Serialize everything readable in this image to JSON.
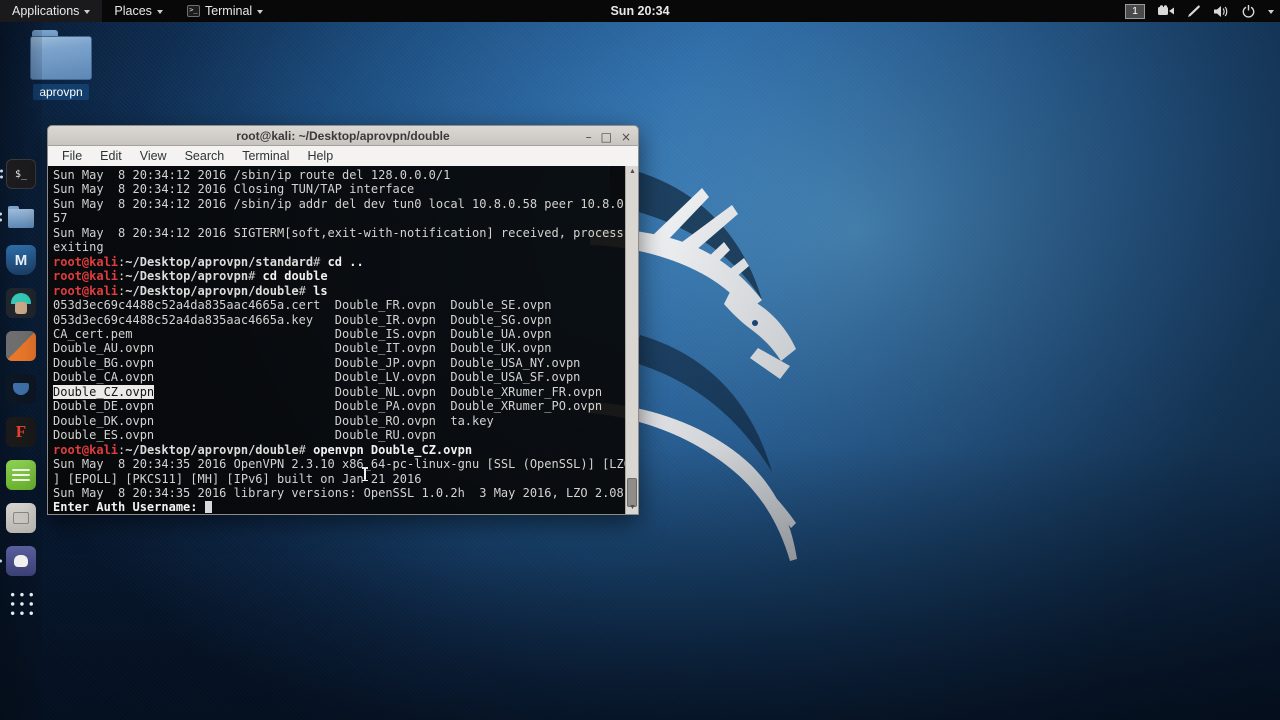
{
  "top_bar": {
    "menus": [
      {
        "label": "Applications"
      },
      {
        "label": "Places"
      },
      {
        "label": "Terminal"
      }
    ],
    "clock": "Sun 20:34",
    "workspace_label": "1",
    "tray_icons": [
      "workspace-switcher",
      "screen-recorder-icon",
      "input-pen-icon",
      "volume-icon",
      "power-icon",
      "caret-down-icon"
    ]
  },
  "desktop": {
    "folder_label": "aprovpn"
  },
  "dock": {
    "items": [
      {
        "name": "terminal",
        "glyph": "$_",
        "running_dots": 2
      },
      {
        "name": "files",
        "running_dots": 2
      },
      {
        "name": "metasploit",
        "glyph": "M",
        "running_dots": 0
      },
      {
        "name": "armitage",
        "running_dots": 0
      },
      {
        "name": "burpsuite",
        "running_dots": 0
      },
      {
        "name": "beef",
        "running_dots": 0
      },
      {
        "name": "faraday",
        "glyph": "F",
        "running_dots": 0
      },
      {
        "name": "leafpad",
        "running_dots": 0
      },
      {
        "name": "gray-app",
        "running_dots": 0
      },
      {
        "name": "dog-app",
        "running_dots": 1
      },
      {
        "name": "show-applications",
        "running_dots": 0
      }
    ]
  },
  "window": {
    "title": "root@kali: ~/Desktop/aprovpn/double",
    "controls": {
      "minimize": "–",
      "maximize": "□",
      "close": "×"
    },
    "menu": [
      "File",
      "Edit",
      "View",
      "Search",
      "Terminal",
      "Help"
    ],
    "scrollbar": {
      "up": "▲",
      "down": "▼"
    }
  },
  "terminal": {
    "columns": 80,
    "lines": [
      {
        "s": [
          [
            "d",
            "Sun May  8 20:34:12 2016 /sbin/ip route del 128.0.0.0/1"
          ]
        ]
      },
      {
        "s": [
          [
            "d",
            "Sun May  8 20:34:12 2016 Closing TUN/TAP interface"
          ]
        ]
      },
      {
        "s": [
          [
            "d",
            "Sun May  8 20:34:12 2016 /sbin/ip addr del dev tun0 local 10.8.0.58 peer 10.8.0."
          ]
        ]
      },
      {
        "s": [
          [
            "d",
            "57"
          ]
        ]
      },
      {
        "s": [
          [
            "d",
            "Sun May  8 20:34:12 2016 SIGTERM[soft,exit-with-notification] received, process"
          ]
        ]
      },
      {
        "s": [
          [
            "d",
            "exiting"
          ]
        ]
      },
      {
        "s": [
          [
            "r",
            "root@kali"
          ],
          [
            "d",
            ":"
          ],
          [
            "g",
            "~/Desktop/aprovpn/standard"
          ],
          [
            "d",
            "# "
          ],
          [
            "b",
            "cd .."
          ]
        ]
      },
      {
        "s": [
          [
            "r",
            "root@kali"
          ],
          [
            "d",
            ":"
          ],
          [
            "g",
            "~/Desktop/aprovpn"
          ],
          [
            "d",
            "# "
          ],
          [
            "b",
            "cd double"
          ]
        ]
      },
      {
        "s": [
          [
            "r",
            "root@kali"
          ],
          [
            "d",
            ":"
          ],
          [
            "g",
            "~/Desktop/aprovpn/double"
          ],
          [
            "d",
            "# "
          ],
          [
            "b",
            "ls"
          ]
        ]
      },
      {
        "s": [
          [
            "d",
            "053d3ec69c4488c52a4da835aac4665a.cert  Double_FR.ovpn  Double_SE.ovpn"
          ]
        ]
      },
      {
        "s": [
          [
            "d",
            "053d3ec69c4488c52a4da835aac4665a.key   Double_IR.ovpn  Double_SG.ovpn"
          ]
        ]
      },
      {
        "s": [
          [
            "d",
            "CA_cert.pem                            Double_IS.ovpn  Double_UA.ovpn"
          ]
        ]
      },
      {
        "s": [
          [
            "d",
            "Double_AU.ovpn                         Double_IT.ovpn  Double_UK.ovpn"
          ]
        ]
      },
      {
        "s": [
          [
            "d",
            "Double_BG.ovpn                         Double_JP.ovpn  Double_USA_NY.ovpn"
          ]
        ]
      },
      {
        "s": [
          [
            "d",
            "Double_CA.ovpn                         Double_LV.ovpn  Double_USA_SF.ovpn"
          ]
        ]
      },
      {
        "s": [
          [
            "h",
            "Double_CZ.ovpn"
          ],
          [
            "d",
            "                         Double_NL.ovpn  Double_XRumer_FR.ovpn"
          ]
        ]
      },
      {
        "s": [
          [
            "d",
            "Double_DE.ovpn                         Double_PA.ovpn  Double_XRumer_PO.ovpn"
          ]
        ]
      },
      {
        "s": [
          [
            "d",
            "Double_DK.ovpn                         Double_RO.ovpn  ta.key"
          ]
        ]
      },
      {
        "s": [
          [
            "d",
            "Double_ES.ovpn                         Double_RU.ovpn"
          ]
        ]
      },
      {
        "s": [
          [
            "r",
            "root@kali"
          ],
          [
            "d",
            ":"
          ],
          [
            "g",
            "~/Desktop/aprovpn/double"
          ],
          [
            "d",
            "# "
          ],
          [
            "b",
            "openvpn Double_CZ.ovpn"
          ]
        ]
      },
      {
        "s": [
          [
            "d",
            "Sun May  8 20:34:35 2016 OpenVPN 2.3.10 x86_64-pc-linux-gnu [SSL (OpenSSL)] [LZO"
          ]
        ]
      },
      {
        "s": [
          [
            "d",
            "] [EPOLL] [PKCS11] [MH] [IPv6] built on Jan 21 2016"
          ]
        ]
      },
      {
        "s": [
          [
            "d",
            "Sun May  8 20:34:35 2016 library versions: OpenSSL 1.0.2h  3 May 2016, LZO 2.08"
          ]
        ]
      },
      {
        "s": [
          [
            "b",
            "Enter Auth Username: "
          ]
        ],
        "cursor": true
      }
    ]
  },
  "colors": {
    "wallpaper_bright": "#4e94c9",
    "wallpaper_dark": "#071a33",
    "prompt_red": "#e23c3c",
    "terminal_bg": "#080808",
    "terminal_fg": "#d3d3d1",
    "titlebar": "#d0ccc7",
    "topbar_bg": "#080809",
    "selection_bg": "#eceae8"
  }
}
